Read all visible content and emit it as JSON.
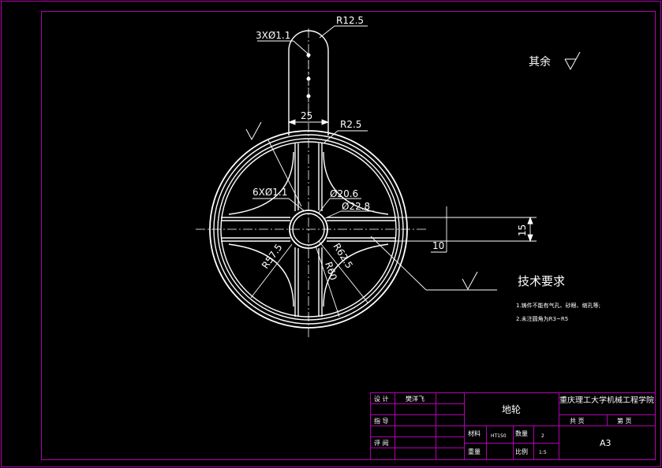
{
  "drawing": {
    "colors": {
      "background": "#000000",
      "border": "#b000b0",
      "line": "#ffffff",
      "text": "#ffffff"
    },
    "dimensions": {
      "r12_5": "R12.5",
      "holes_3": "3XØ1.1",
      "width_25": "25",
      "r2_5": "R2.5",
      "holes_6": "6XØ1.1",
      "d20_6": "Ø20.6",
      "d22_8": "Ø22.8",
      "d15": "15",
      "d10": "10",
      "r57_5": "R57.5",
      "r60": "R60",
      "r62_5": "R62.5"
    },
    "surface_mark": "其余",
    "tech_title": "技术要求",
    "tech_notes": [
      "1.铸件不能有气孔、砂眼、缩孔等;",
      "2.未注圆角为R3~R5"
    ]
  },
  "title_block": {
    "design_label": "设 计",
    "designer": "樊洋飞",
    "guide_label": "指 导",
    "review_label": "评 阅",
    "part_name": "地轮",
    "material_label": "材料",
    "material": "HT150",
    "quantity_label": "数量",
    "quantity": "2",
    "weight_label": "重量",
    "scale_label": "比例",
    "scale": "1:5",
    "school": "重庆理工大学机械工程学院",
    "sheets_total_label": "共    页",
    "sheet_label": "第    页",
    "paper": "A3"
  }
}
